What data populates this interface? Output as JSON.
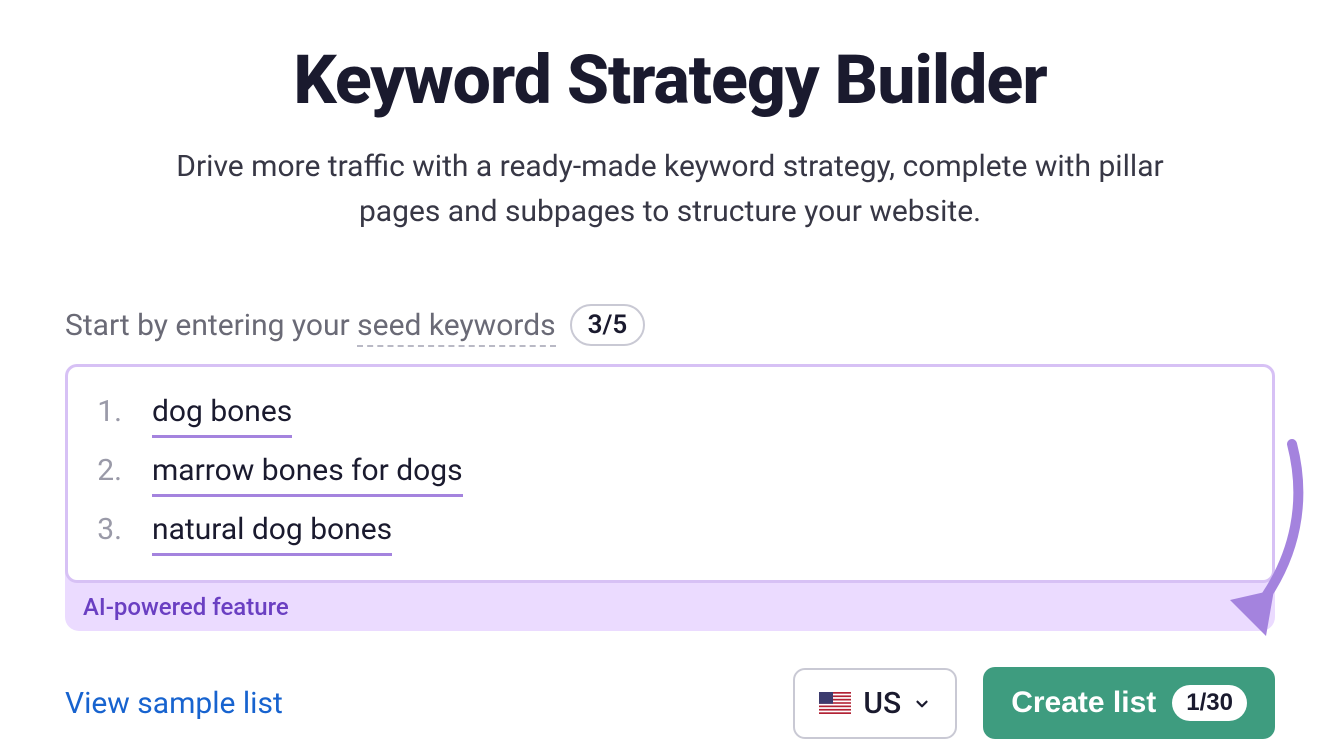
{
  "title": "Keyword Strategy Builder",
  "subtitle": "Drive more traffic with a ready-made keyword strategy, complete with pillar pages and subpages to structure your website.",
  "prompt": {
    "prefix": "Start by entering your ",
    "seed_label": "seed keywords",
    "counter": "3/5"
  },
  "keywords": [
    {
      "n": "1.",
      "text": "dog bones"
    },
    {
      "n": "2.",
      "text": "marrow bones for dogs"
    },
    {
      "n": "3.",
      "text": "natural dog bones"
    }
  ],
  "ai_label": "AI-powered feature",
  "sample_link": "View sample list",
  "country": {
    "code": "US",
    "flag": "us"
  },
  "create": {
    "label": "Create list",
    "badge": "1/30"
  }
}
